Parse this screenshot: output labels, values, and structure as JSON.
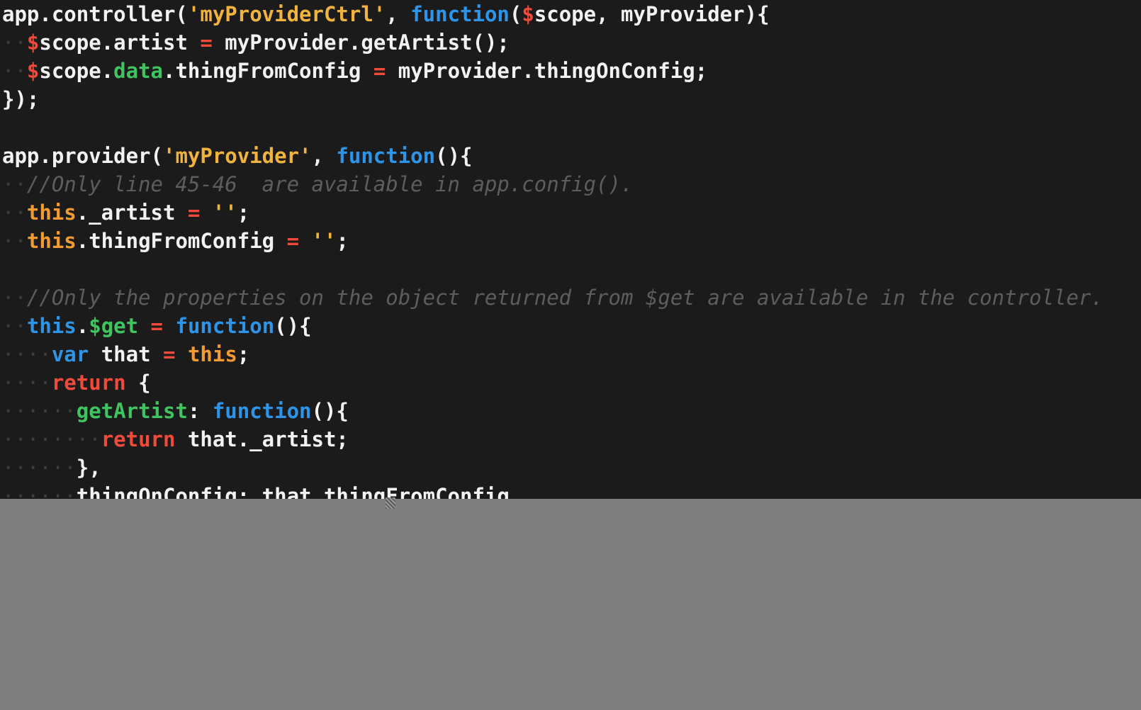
{
  "editor": {
    "lines": [
      [
        {
          "t": "app.controller(",
          "k": "txt"
        },
        {
          "t": "'myProviderCtrl'",
          "k": "str"
        },
        {
          "t": ", ",
          "k": "txt"
        },
        {
          "t": "function",
          "k": "fn"
        },
        {
          "t": "(",
          "k": "txt"
        },
        {
          "t": "$",
          "k": "dol"
        },
        {
          "t": "scope, myProvider){",
          "k": "txt"
        }
      ],
      [
        {
          "t": "··",
          "k": "ind"
        },
        {
          "t": "$",
          "k": "dol"
        },
        {
          "t": "scope.artist ",
          "k": "txt"
        },
        {
          "t": "=",
          "k": "op"
        },
        {
          "t": " myProvider.getArtist();",
          "k": "txt"
        }
      ],
      [
        {
          "t": "··",
          "k": "ind"
        },
        {
          "t": "$",
          "k": "dol"
        },
        {
          "t": "scope.",
          "k": "txt"
        },
        {
          "t": "data",
          "k": "prop"
        },
        {
          "t": ".thingFromConfig ",
          "k": "txt"
        },
        {
          "t": "=",
          "k": "op"
        },
        {
          "t": " myProvider.thingOnConfig;",
          "k": "txt"
        }
      ],
      [
        {
          "t": "});",
          "k": "txt"
        }
      ],
      [],
      [
        {
          "t": "app.provider(",
          "k": "txt"
        },
        {
          "t": "'myProvider'",
          "k": "str"
        },
        {
          "t": ", ",
          "k": "txt"
        },
        {
          "t": "function",
          "k": "fn"
        },
        {
          "t": "(){",
          "k": "txt"
        }
      ],
      [
        {
          "t": "··",
          "k": "ind"
        },
        {
          "t": "//Only line 45-46  are available in app.config().",
          "k": "cm"
        }
      ],
      [
        {
          "t": "··",
          "k": "ind"
        },
        {
          "t": "this",
          "k": "this"
        },
        {
          "t": "._artist ",
          "k": "txt"
        },
        {
          "t": "=",
          "k": "op"
        },
        {
          "t": " ",
          "k": "txt"
        },
        {
          "t": "''",
          "k": "str"
        },
        {
          "t": ";",
          "k": "txt"
        }
      ],
      [
        {
          "t": "··",
          "k": "ind"
        },
        {
          "t": "this",
          "k": "this"
        },
        {
          "t": ".thingFromConfig ",
          "k": "txt"
        },
        {
          "t": "=",
          "k": "op"
        },
        {
          "t": " ",
          "k": "txt"
        },
        {
          "t": "''",
          "k": "str"
        },
        {
          "t": ";",
          "k": "txt"
        }
      ],
      [],
      [
        {
          "t": "··",
          "k": "ind"
        },
        {
          "t": "//Only the properties on the object returned from $get are available in the controller.",
          "k": "cm"
        }
      ],
      [
        {
          "t": "··",
          "k": "ind"
        },
        {
          "t": "this",
          "k": "fn"
        },
        {
          "t": ".",
          "k": "txt"
        },
        {
          "t": "$get",
          "k": "prop"
        },
        {
          "t": " ",
          "k": "txt"
        },
        {
          "t": "=",
          "k": "op"
        },
        {
          "t": " ",
          "k": "txt"
        },
        {
          "t": "function",
          "k": "fn"
        },
        {
          "t": "(){",
          "k": "txt"
        }
      ],
      [
        {
          "t": "····",
          "k": "ind"
        },
        {
          "t": "var",
          "k": "fn"
        },
        {
          "t": " that ",
          "k": "txt"
        },
        {
          "t": "=",
          "k": "op"
        },
        {
          "t": " ",
          "k": "txt"
        },
        {
          "t": "this",
          "k": "this"
        },
        {
          "t": ";",
          "k": "txt"
        }
      ],
      [
        {
          "t": "····",
          "k": "ind"
        },
        {
          "t": "return",
          "k": "ret"
        },
        {
          "t": " {",
          "k": "txt"
        }
      ],
      [
        {
          "t": "······",
          "k": "ind"
        },
        {
          "t": "getArtist",
          "k": "prop"
        },
        {
          "t": ": ",
          "k": "txt"
        },
        {
          "t": "function",
          "k": "fn"
        },
        {
          "t": "(){",
          "k": "txt"
        }
      ],
      [
        {
          "t": "········",
          "k": "ind"
        },
        {
          "t": "return",
          "k": "ret"
        },
        {
          "t": " that._artist;",
          "k": "txt"
        }
      ],
      [
        {
          "t": "······",
          "k": "ind"
        },
        {
          "t": "},",
          "k": "txt"
        }
      ],
      [
        {
          "t": "······",
          "k": "ind"
        },
        {
          "t": "thingOnConfig: that.thingFromConfig",
          "k": "txt"
        }
      ]
    ]
  }
}
